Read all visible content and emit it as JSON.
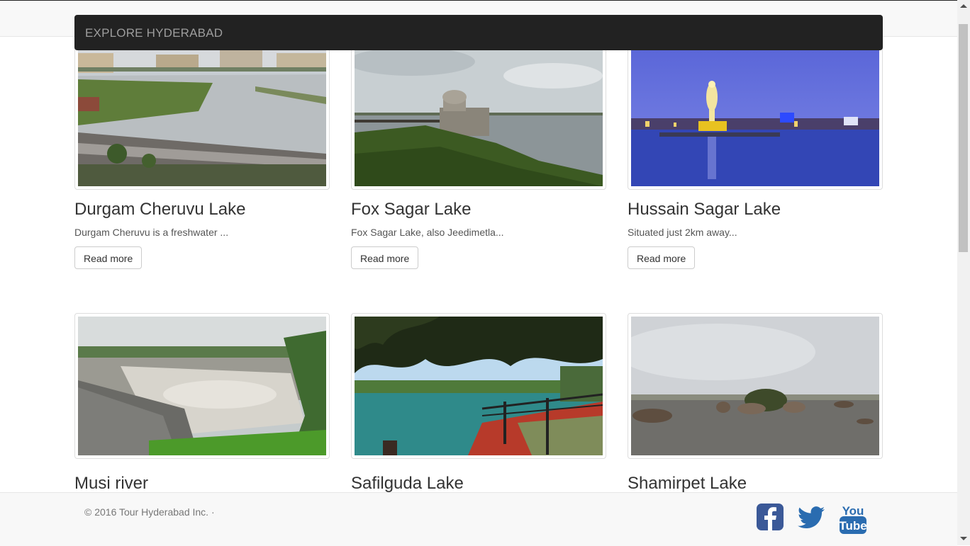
{
  "navbar": {
    "brand": "EXPLORE HYDERABAD"
  },
  "cards": [
    {
      "title": "Durgam Cheruvu Lake",
      "description": "Durgam Cheruvu is a freshwater ...",
      "button": "Read more",
      "image": "lake-city-promenade"
    },
    {
      "title": "Fox Sagar Lake",
      "description": "Fox Sagar Lake, also Jeedimetla...",
      "button": "Read more",
      "image": "lake-tower-bridge"
    },
    {
      "title": "Hussain Sagar Lake",
      "description": "Situated just 2km away...",
      "button": "Read more",
      "image": "buddha-statue-night"
    },
    {
      "title": "Musi river",
      "image": "river-weir-flood"
    },
    {
      "title": "Safilguda Lake",
      "image": "lake-trees-railing"
    },
    {
      "title": "Shamirpet Lake",
      "image": "lake-rocks-dusk"
    }
  ],
  "footer": {
    "copyright": "© 2016 Tour Hyderabad Inc. ·",
    "social": [
      {
        "icon": "facebook-icon",
        "color": "#3b5998"
      },
      {
        "icon": "twitter-icon",
        "color": "#2a6cb0"
      },
      {
        "icon": "youtube-icon",
        "color": "#2a6cb0",
        "text_top": "You",
        "text_bottom": "Tube"
      }
    ]
  },
  "colors": {
    "navbar_bg": "#222222",
    "brand_text": "#9d9d9d",
    "footer_bg": "#f8f8f8"
  }
}
